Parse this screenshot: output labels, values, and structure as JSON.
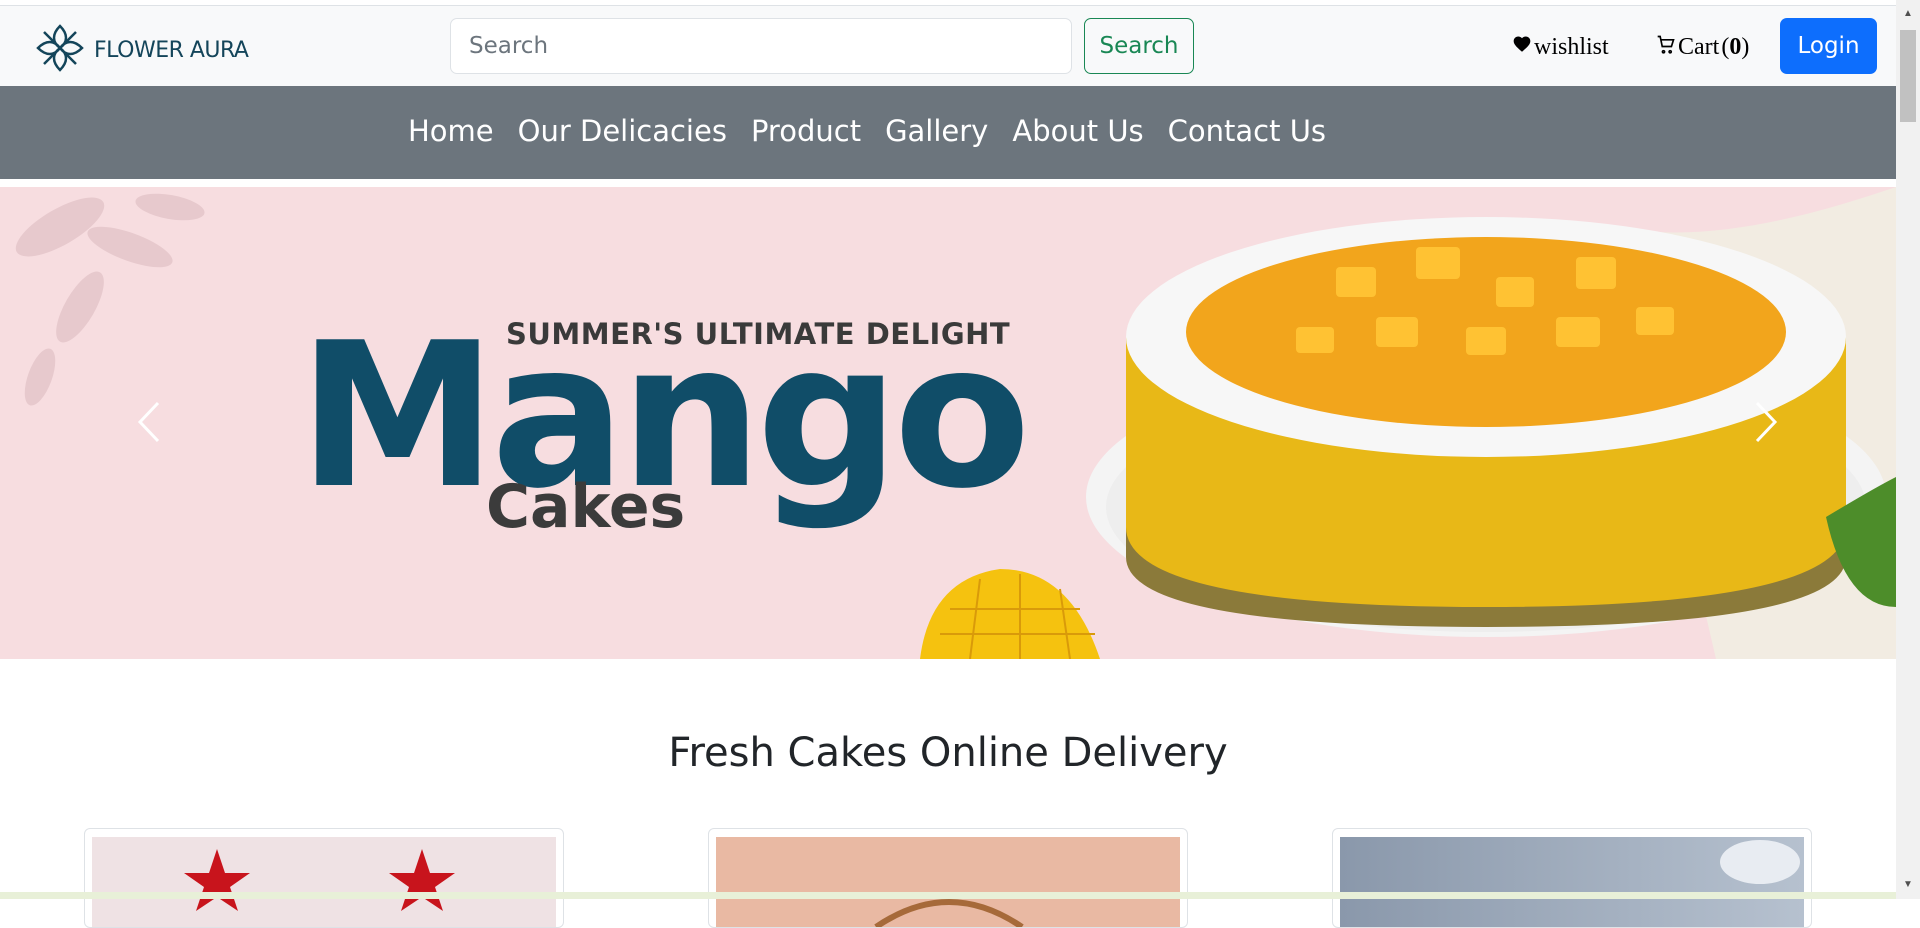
{
  "header": {
    "logo_text": "FLOWER AURA",
    "search_placeholder": "Search",
    "search_button": "Search",
    "wishlist_label": "wishlist",
    "cart_label": "Cart",
    "cart_count": "0",
    "login_button": "Login"
  },
  "nav": {
    "items": [
      {
        "label": "Home"
      },
      {
        "label": "Our Delicacies"
      },
      {
        "label": "Product"
      },
      {
        "label": "Gallery"
      },
      {
        "label": "About Us"
      },
      {
        "label": "Contact Us"
      }
    ]
  },
  "banner": {
    "subtitle": "SUMMER'S ULTIMATE DELIGHT",
    "title": "Mango",
    "title2": "Cakes"
  },
  "main": {
    "section_title": "Fresh Cakes Online Delivery"
  },
  "colors": {
    "primary": "#0d6efd",
    "success": "#198754",
    "nav_bg": "#6c757d",
    "banner_bg": "#f7dde0",
    "brand": "#14455a"
  }
}
